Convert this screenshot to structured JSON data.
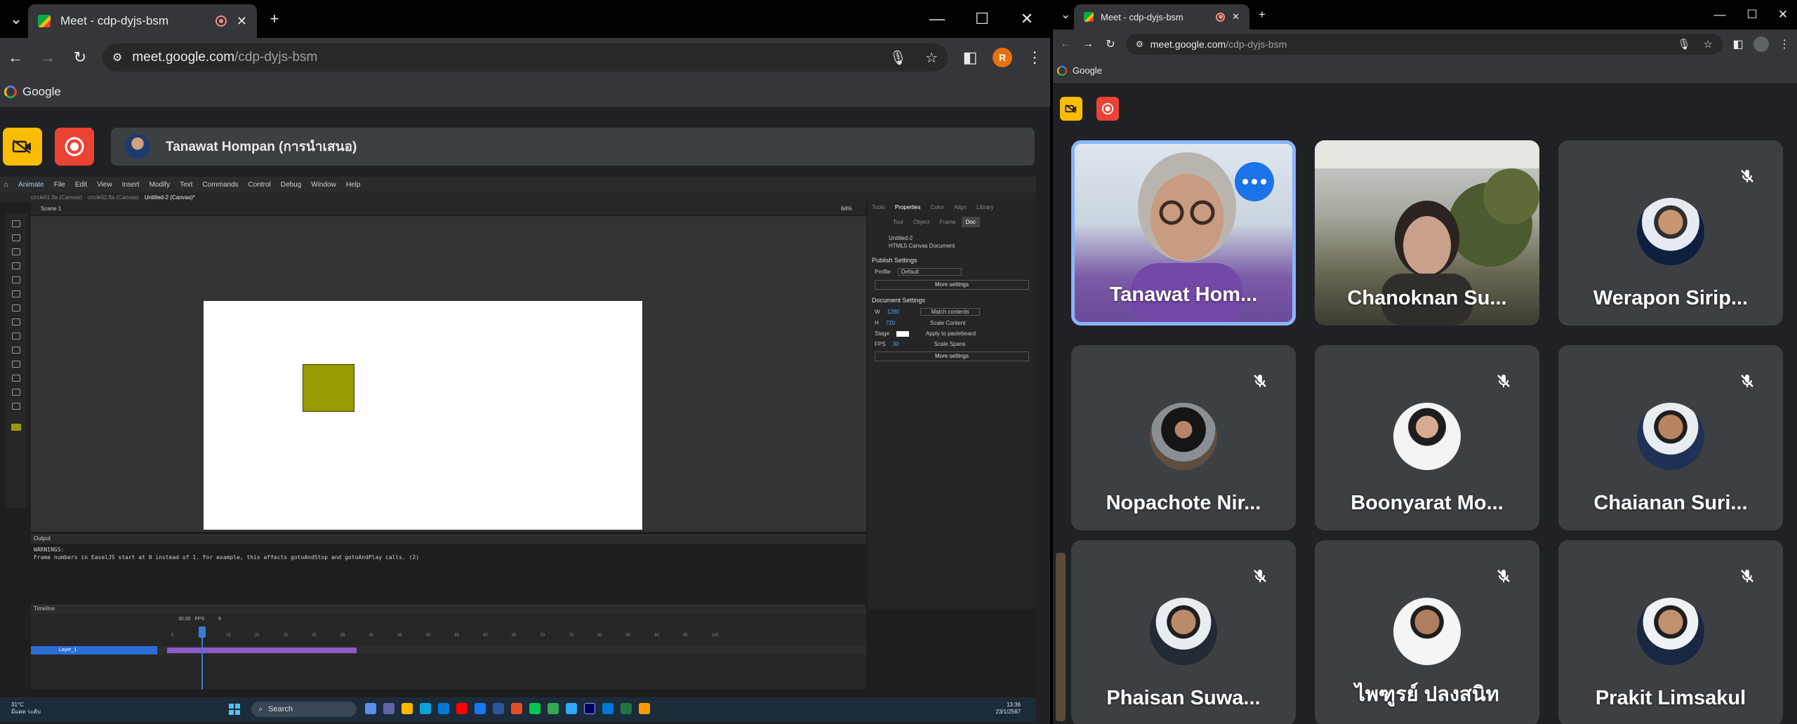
{
  "left_window": {
    "tab_title": "Meet - cdp-dyjs-bsm",
    "url_host": "meet.google.com",
    "url_path": "/cdp-dyjs-bsm",
    "profile_initial": "R",
    "bookmark": "Google",
    "presenter_label": "Tanawat Hompan (การนำเสนอ)",
    "shared_screen": {
      "app_name": "Animate",
      "menus": [
        "File",
        "Edit",
        "View",
        "Insert",
        "Modify",
        "Text",
        "Commands",
        "Control",
        "Debug",
        "Window",
        "Help"
      ],
      "doc_tabs": [
        "circle01.fla (Canvas)",
        "circle02.fla (Canvas)",
        "Untitled-2 (Canvas)*"
      ],
      "scene": "Scene 1",
      "zoom": "64%",
      "prop_tabs": [
        "Tools",
        "Properties",
        "Color",
        "Align",
        "Library"
      ],
      "prop_subtabs": [
        "Tool",
        "Object",
        "Frame",
        "Doc"
      ],
      "doc_name": "Untitled-2",
      "doc_type": "HTML5 Canvas Document",
      "publish_settings": "Publish Settings",
      "profile_label": "Profile",
      "profile_value": "Default",
      "more_settings": "More settings",
      "document_settings": "Document Settings",
      "width_label": "W",
      "width_value": "1280",
      "height_label": "H",
      "height_value": "720",
      "match_contents": "Match contents",
      "scale_content": "Scale Content",
      "stage_label": "Stage",
      "apply_pasteboard": "Apply to pasteboard",
      "fps_label": "FPS",
      "fps_value": "30",
      "scale_spans": "Scale Spans",
      "more_settings_2": "More settings",
      "output_title": "Output",
      "output_text": "WARNINGS:\nFrame numbers in EaselJS start at 0 instead of 1. For example, this affects gotoAndStop and gotoAndPlay calls. (2)",
      "timeline_title": "Timeline",
      "layer_name": "Layer_1",
      "fps_readout": "30.00",
      "fps_unit": "FPS",
      "frame_readout": "6",
      "ruler": [
        "5",
        "10",
        "15",
        "20",
        "25",
        "30",
        "35",
        "40",
        "45",
        "50",
        "55",
        "60",
        "65",
        "70",
        "75",
        "80",
        "85",
        "90",
        "95",
        "100"
      ],
      "taskbar_search": "Search",
      "weather_temp": "31°C",
      "weather_desc": "มีแดด ระดับ",
      "clock_time": "13:36",
      "clock_date": "23/1/2567"
    }
  },
  "right_window": {
    "tab_title": "Meet - cdp-dyjs-bsm",
    "url_host": "meet.google.com",
    "url_path": "/cdp-dyjs-bsm",
    "bookmark": "Google",
    "participants": [
      {
        "name": "Tanawat Hom...",
        "muted": false,
        "active": true
      },
      {
        "name": "Chanoknan Su...",
        "muted": false,
        "active": false
      },
      {
        "name": "Werapon Sirip...",
        "muted": true,
        "active": false
      },
      {
        "name": "Nopachote Nir...",
        "muted": true,
        "active": false
      },
      {
        "name": "Boonyarat Mo...",
        "muted": true,
        "active": false
      },
      {
        "name": "Chaianan Suri...",
        "muted": true,
        "active": false
      },
      {
        "name": "Phaisan Suwa...",
        "muted": true,
        "active": false
      },
      {
        "name": "ไพฑูรย์ ปลงสนิท",
        "muted": true,
        "active": false
      },
      {
        "name": "Prakit Limsakul",
        "muted": true,
        "active": false
      }
    ]
  },
  "colors": {
    "meet_bg": "#202124",
    "tile_bg": "#3c4043",
    "active_border": "#8ab4f8",
    "control_yellow": "#fbbc04",
    "control_red": "#ea4335",
    "stage_square": "#999900"
  }
}
